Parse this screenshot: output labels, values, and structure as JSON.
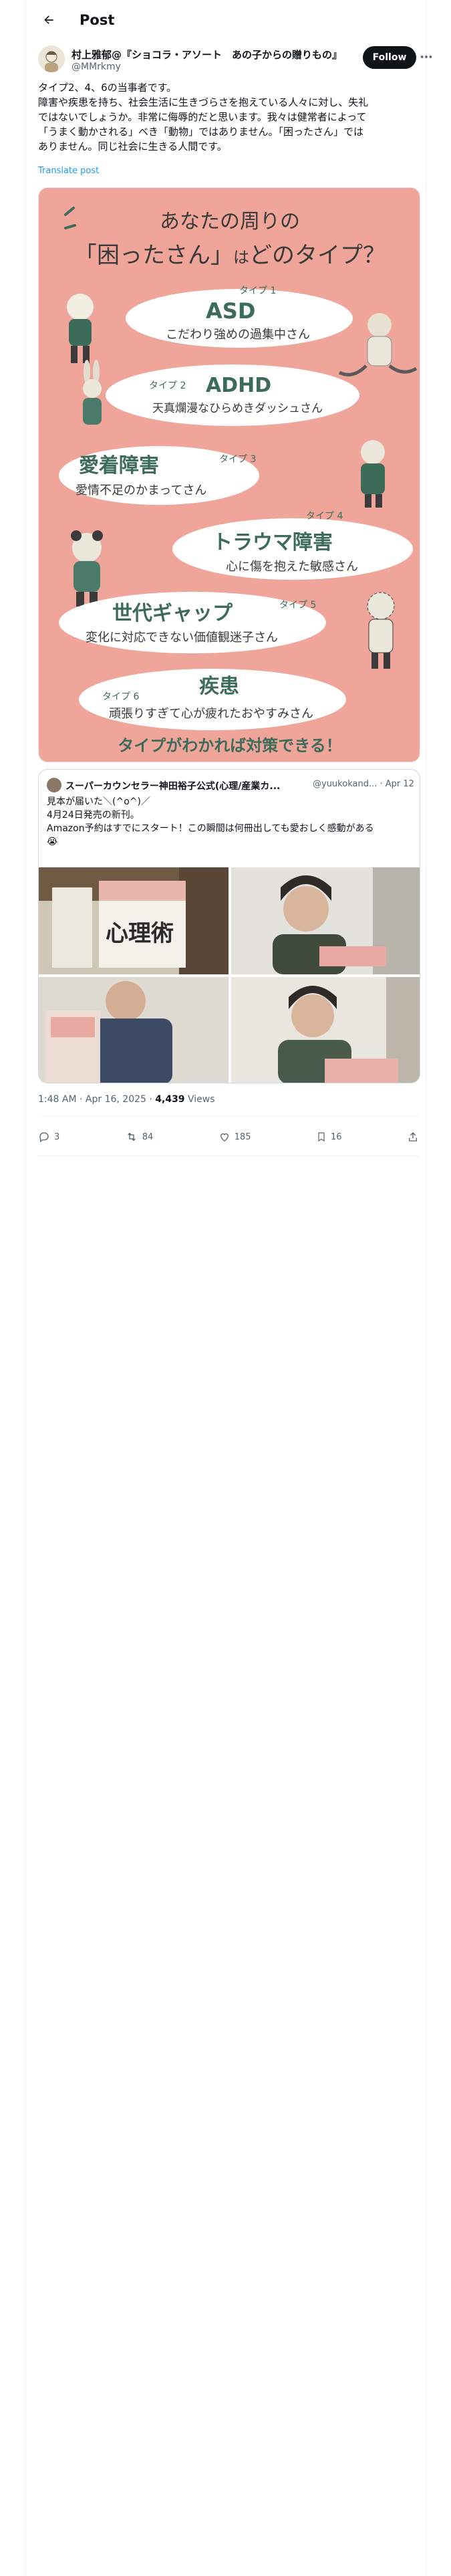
{
  "header": {
    "title": "Post"
  },
  "author": {
    "name": "村上雅郁@『ショコラ・アソート　あの子からの贈りもの』",
    "handle": "@MMrkmy",
    "follow_label": "Follow"
  },
  "post": {
    "lines": [
      "タイプ2、4、6の当事者です。",
      "障害や疾患を持ち、社会生活に生きづらさを抱えている人々に対し、失礼",
      "ではないでしょうか。非常に侮辱的だと思います。我々は健常者によって",
      "「うまく動かされる」べき「動物」ではありません。「困ったさん」では",
      "ありません。同じ社会に生きる人間です。"
    ],
    "translate_label": "Translate post"
  },
  "poster": {
    "title_line1": "あなたの周りの",
    "title_line2a": "「困ったさん」",
    "title_line2b": "は",
    "title_line2c": "どのタイプ？",
    "types": [
      {
        "tag": "タイプ 1",
        "name": "ASD",
        "desc": "こだわり強めの過集中さん"
      },
      {
        "tag": "タイプ 2",
        "name": "ADHD",
        "desc": "天真爛漫なひらめきダッシュさん"
      },
      {
        "tag": "タイプ 3",
        "name": "愛着障害",
        "desc": "愛情不足のかまってさん"
      },
      {
        "tag": "タイプ 4",
        "name": "トラウマ障害",
        "desc": "心に傷を抱えた敏感さん"
      },
      {
        "tag": "タイプ 5",
        "name": "世代ギャップ",
        "desc": "変化に対応できない価値観迷子さん"
      },
      {
        "tag": "タイプ 6",
        "name": "疾患",
        "desc": "頑張りすぎて心が疲れたおやすみさん"
      }
    ],
    "footer": "タイプがわかれば対策できる！"
  },
  "quote": {
    "name": "スーパーカウンセラー神田裕子公式(心理/産業カ...",
    "handle": "@yuukokand... · Apr 12",
    "lines": [
      "見本が届いた＼(^o^)／",
      "4月24日発売の新刊。",
      "Amazon予約はすでにスタート！この瞬間は何冊出しても愛おしく感動がある",
      "😭"
    ],
    "book_title": "心理術"
  },
  "meta": {
    "time": "1:48 AM · Apr 16, 2025 · ",
    "views_count": "4,439",
    "views_label": " Views"
  },
  "actions": {
    "replies": "3",
    "reposts": "84",
    "likes": "185",
    "bookmarks": "16"
  },
  "colors": {
    "poster_bg": "#f0a59a",
    "accent_green": "#3d6b5a",
    "follow_bg": "#0f1419",
    "link": "#1d9bf0"
  }
}
